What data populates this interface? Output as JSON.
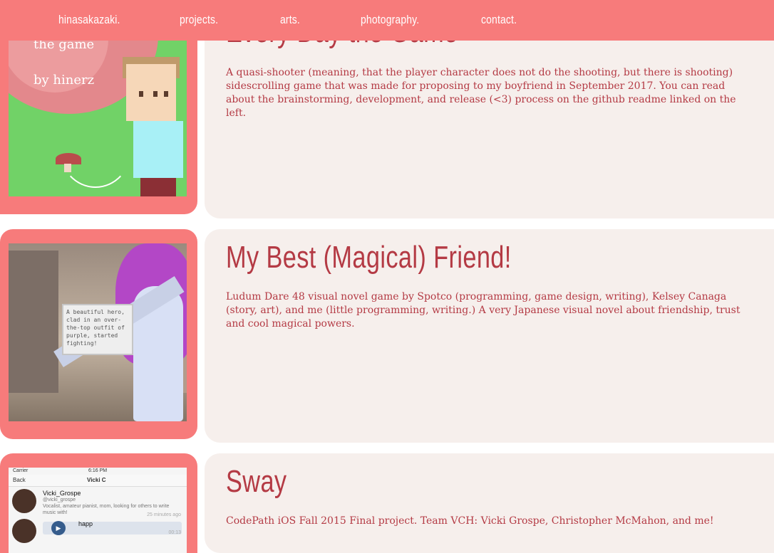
{
  "nav": {
    "brand": "hinasakazaki.",
    "items": [
      "projects.",
      "arts.",
      "photography.",
      "contact."
    ]
  },
  "projects": [
    {
      "title": "Every Day the Game",
      "description": "A quasi-shooter (meaning, that the player character does not do the shooting, but there is shooting) sidescrolling game that was made for proposing to my boyfriend in September 2017. You can read about the brainstorming, development, and release (<3) process on the github readme linked on the left.",
      "thumb_text": [
        "the game",
        "by hinerz"
      ]
    },
    {
      "title": "My Best (Magical) Friend!",
      "description": "Ludum Dare 48 visual novel game by Spotco (programming, game design, writing), Kelsey Canaga (story, art), and me (little programming, writing.) A very Japanese visual novel about friendship, trust and cool magical powers.",
      "thumb_text": "A beautiful hero, clad in an over-the-top outfit of purple, started fighting!"
    },
    {
      "title": "Sway",
      "description": "CodePath iOS Fall 2015 Final project. Team VCH: Vicki Grospe, Christopher McMahon, and me!",
      "thumb": {
        "carrier": "Carrier",
        "clock": "6:16 PM",
        "back": "Back",
        "header": "Vicki C",
        "user_name": "Vicki_Grospe",
        "handle": "@vicki_grospe",
        "bio": "Vocalist, amateur pianist, mom, looking for others to write music with!",
        "time": "25 minutes ago",
        "audio_label": "happ",
        "audio_time": "00:13"
      }
    }
  ]
}
